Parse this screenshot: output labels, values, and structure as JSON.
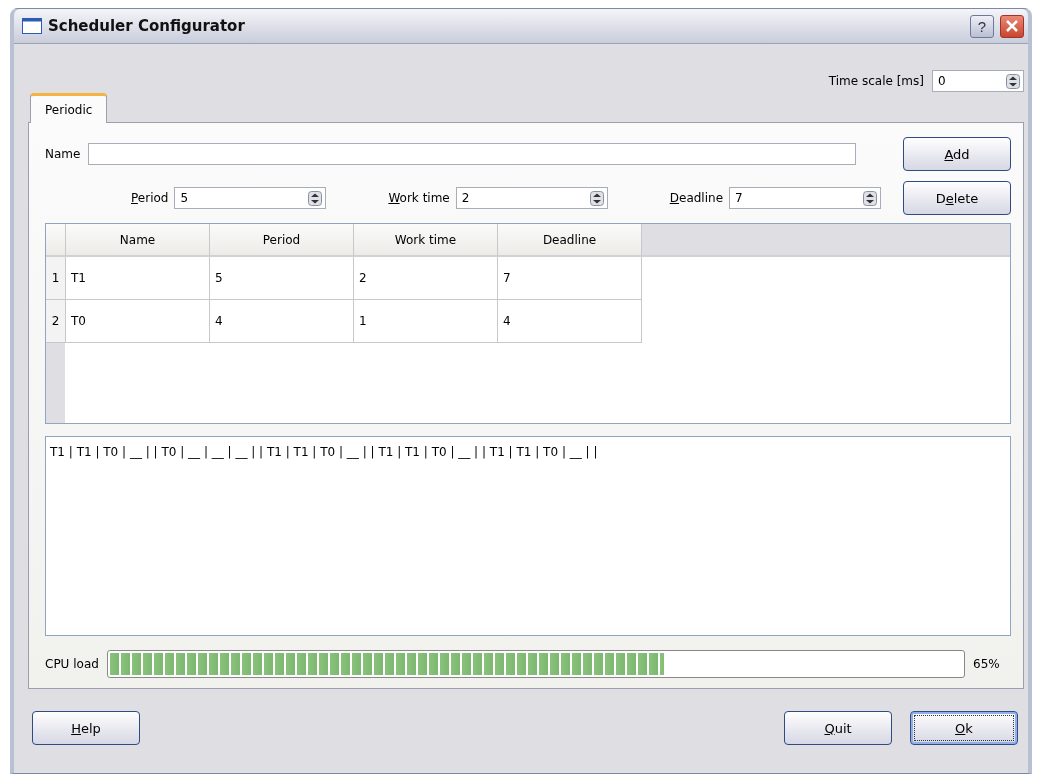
{
  "window": {
    "title": "Scheduler Configurator",
    "help_button": "?"
  },
  "time_scale": {
    "label": "Time scale [ms]",
    "value": "0"
  },
  "tabs": [
    {
      "label": "Periodic",
      "selected": true
    }
  ],
  "name_field": {
    "label": "Name"
  },
  "params": [
    {
      "label": [
        {
          "text": "P",
          "underlined": true
        },
        {
          "text": "eriod",
          "underlined": false
        }
      ],
      "value": "5"
    },
    {
      "label": [
        {
          "text": "W",
          "underlined": true
        },
        {
          "text": "ork time",
          "underlined": false
        }
      ],
      "value": "2"
    },
    {
      "label": [
        {
          "text": "D",
          "underlined": true
        },
        {
          "text": "eadline",
          "underlined": false
        }
      ],
      "value": "7"
    }
  ],
  "side_buttons": [
    {
      "label": [
        {
          "text": "A",
          "underlined": true
        },
        {
          "text": "dd",
          "underlined": false
        }
      ]
    },
    {
      "label": [
        {
          "text": "D",
          "underlined": false
        },
        {
          "text": "e",
          "underlined": true
        },
        {
          "text": "lete",
          "underlined": false
        }
      ]
    }
  ],
  "table": {
    "columns": [
      "Name",
      "Period",
      "Work time",
      "Deadline"
    ],
    "rows": [
      {
        "number": "1",
        "cells": [
          "T1",
          "5",
          "2",
          "7"
        ]
      },
      {
        "number": "2",
        "cells": [
          "T0",
          "4",
          "1",
          "4"
        ]
      }
    ]
  },
  "schedule_text": "T1 | T1 | T0 | __ | | T0 | __ | __ | __ | | T1 | T1 | T0 | __ | | T1 | T1 | T0 | __ | | T1 | T1 | T0 | __ | |",
  "cpu_load": {
    "label": "CPU load",
    "level": 0.65,
    "reading": "65%"
  },
  "footer_buttons": [
    {
      "label": [
        {
          "text": "H",
          "underlined": true
        },
        {
          "text": "elp",
          "underlined": false
        }
      ],
      "default": false
    },
    {
      "label": [
        {
          "text": "Q",
          "underlined": true
        },
        {
          "text": "uit",
          "underlined": false
        }
      ],
      "default": false
    },
    {
      "label": [
        {
          "text": "O",
          "underlined": true
        },
        {
          "text": "k",
          "underlined": false
        }
      ],
      "default": true
    }
  ]
}
